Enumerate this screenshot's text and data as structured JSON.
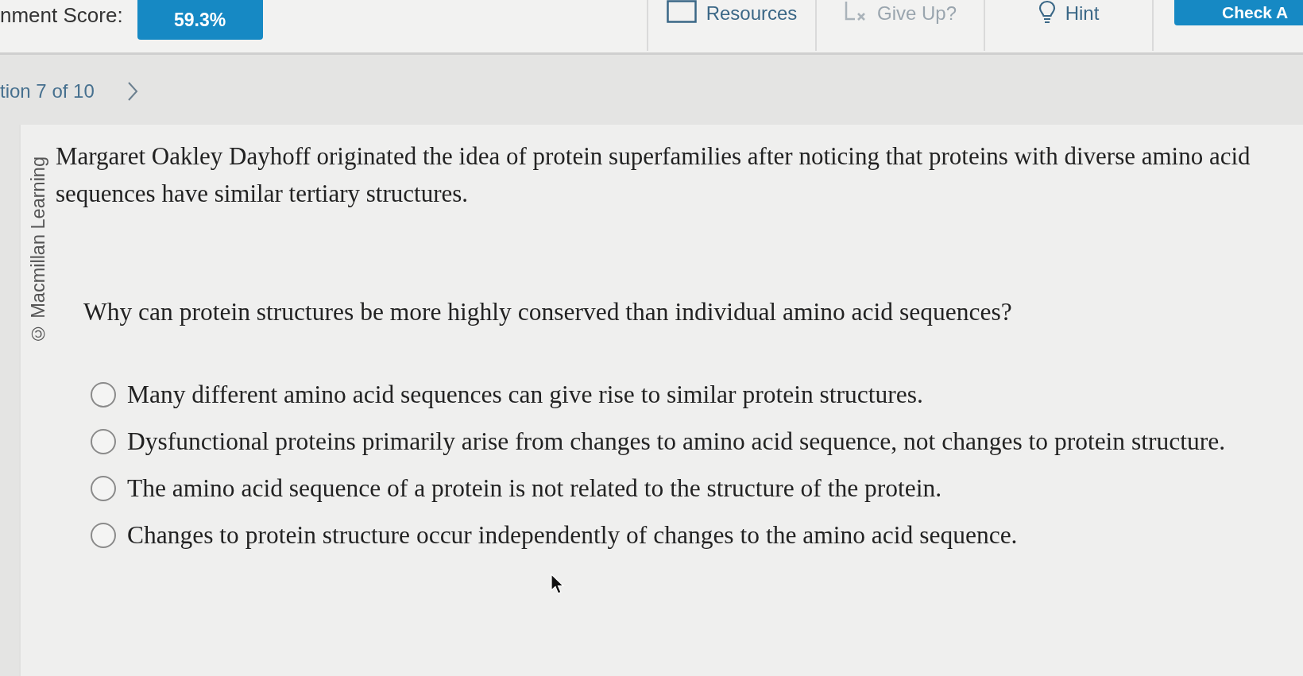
{
  "header": {
    "score_label": "nment Score:",
    "score": "59.3%",
    "tools": [
      {
        "label": "Resources",
        "disabled": false
      },
      {
        "label": "Give Up?",
        "disabled": true
      },
      {
        "label": "Hint",
        "disabled": false
      }
    ],
    "check_button": {
      "label": "Check A"
    }
  },
  "question_nav": {
    "label": "tion 7 of 10"
  },
  "card": {
    "copyright": "© Macmillan Learning",
    "intro": "Margaret Oakley Dayhoff originated the idea of protein superfamilies after noticing that proteins with diverse amino acid sequences have similar tertiary structures.",
    "question": "Why can protein structures be more highly conserved than individual amino acid sequences?",
    "options": [
      {
        "label": "Many different amino acid sequences can give rise to similar protein structures.",
        "selected": false
      },
      {
        "label": "Dysfunctional proteins primarily arise from changes to amino acid sequence, not changes to protein structure.",
        "selected": false
      },
      {
        "label": "The amino acid sequence of a protein is not related to the structure of the protein.",
        "selected": false
      },
      {
        "label": "Changes to protein structure occur independently of changes to the amino acid sequence.",
        "selected": false
      }
    ]
  }
}
